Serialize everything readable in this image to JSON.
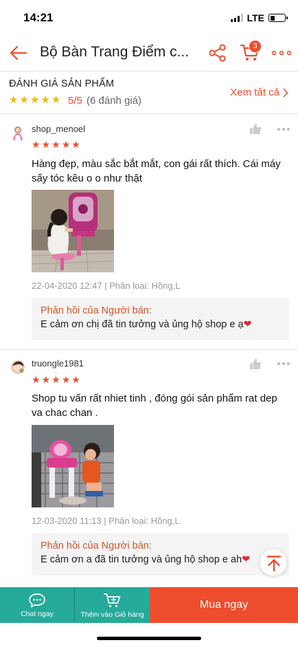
{
  "status_bar": {
    "time": "14:21",
    "network": "LTE",
    "battery_level": 0.3
  },
  "header": {
    "title": "Bộ Bàn Trang Điểm c...",
    "cart_count": "3",
    "icons": {
      "back": "back-arrow-icon",
      "share": "share-icon",
      "cart": "cart-icon",
      "more": "more-icon"
    }
  },
  "summary": {
    "title": "ĐÁNH GIÁ SẢN PHẨM",
    "stars": [
      "★",
      "★",
      "★",
      "★",
      "★"
    ],
    "rating": "5/5",
    "count": "(6 đánh giá)",
    "see_all": "Xem tất cả"
  },
  "reviews": [
    {
      "username": "shop_menoel",
      "stars": [
        "★",
        "★",
        "★",
        "★",
        "★"
      ],
      "text": "Hàng đẹp, màu sắc bắt mắt, con gái rất thích. Cái máy sấy tóc kêu o o như thật",
      "meta": "22-04-2020 12:47 | Phân loại: Hồng,L",
      "reply_title": "Phản hồi của Người bán:",
      "reply_text": "E cảm ơn chị đã tin tưởng và ủng hộ shop e ạ"
    },
    {
      "username": "truongle1981",
      "stars": [
        "★",
        "★",
        "★",
        "★",
        "★"
      ],
      "text": "Shop tu vấn rất nhiet tinh , đóng gói sản phẩm rat dep va chac chan .",
      "meta": "12-03-2020 11:13 | Phân loại: Hồng,L",
      "reply_title": "Phản hồi của Người bán:",
      "reply_text": "E cảm ơn a đã tin tưởng và ủng hộ shop e ah"
    }
  ],
  "bottom_bar": {
    "chat_label": "Chat ngay",
    "add_cart_label": "Thêm vào Giỏ hàng",
    "buy_label": "Mua ngay"
  },
  "colors": {
    "accent": "#ee4d2d",
    "star": "#f5b800",
    "teal": "#26aa99"
  }
}
